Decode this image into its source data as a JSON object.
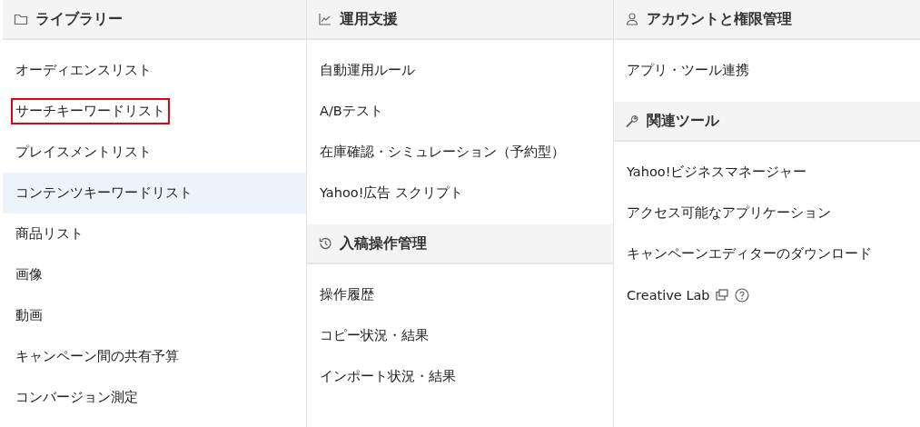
{
  "columns": [
    {
      "sections": [
        {
          "title": "ライブラリー",
          "kind": "folder",
          "items": [
            {
              "label": "オーディエンスリスト",
              "kind": "link",
              "highlighted": false,
              "marked": false
            },
            {
              "label": "サーチキーワードリスト",
              "kind": "link",
              "highlighted": false,
              "marked": true
            },
            {
              "label": "プレイスメントリスト",
              "kind": "link",
              "highlighted": false,
              "marked": false
            },
            {
              "label": "コンテンツキーワードリスト",
              "kind": "link",
              "highlighted": true,
              "marked": false
            },
            {
              "label": "商品リスト",
              "kind": "link",
              "highlighted": false,
              "marked": false
            },
            {
              "label": "画像",
              "kind": "link",
              "highlighted": false,
              "marked": false
            },
            {
              "label": "動画",
              "kind": "link",
              "highlighted": false,
              "marked": false
            },
            {
              "label": "キャンペーン間の共有予算",
              "kind": "link",
              "highlighted": false,
              "marked": false
            },
            {
              "label": "コンバージョン測定",
              "kind": "link",
              "highlighted": false,
              "marked": false
            }
          ]
        }
      ]
    },
    {
      "sections": [
        {
          "title": "運用支援",
          "kind": "chart",
          "items": [
            {
              "label": "自動運用ルール",
              "kind": "link",
              "highlighted": false,
              "marked": false
            },
            {
              "label": "A/Bテスト",
              "kind": "link",
              "highlighted": false,
              "marked": false
            },
            {
              "label": "在庫確認・シミュレーション（予約型）",
              "kind": "link",
              "highlighted": false,
              "marked": false
            },
            {
              "label": "Yahoo!広告 スクリプト",
              "kind": "link",
              "highlighted": false,
              "marked": false
            }
          ]
        },
        {
          "title": "入稿操作管理",
          "kind": "history",
          "items": [
            {
              "label": "操作履歴",
              "kind": "link",
              "highlighted": false,
              "marked": false
            },
            {
              "label": "コピー状況・結果",
              "kind": "link",
              "highlighted": false,
              "marked": false
            },
            {
              "label": "インポート状況・結果",
              "kind": "link",
              "highlighted": false,
              "marked": false
            }
          ]
        }
      ]
    },
    {
      "sections": [
        {
          "title": "アカウントと権限管理",
          "kind": "user",
          "items": [
            {
              "label": "アプリ・ツール連携",
              "kind": "link",
              "highlighted": false,
              "marked": false
            }
          ]
        },
        {
          "title": "関連ツール",
          "kind": "wrench",
          "items": [
            {
              "label": "Yahoo!ビジネスマネージャー",
              "kind": "link",
              "highlighted": false,
              "marked": false
            },
            {
              "label": "アクセス可能なアプリケーション",
              "kind": "link",
              "highlighted": false,
              "marked": false
            },
            {
              "label": "キャンペーンエディターのダウンロード",
              "kind": "link",
              "highlighted": false,
              "marked": false
            },
            {
              "label": "Creative Lab",
              "kind": "external-link",
              "highlighted": false,
              "marked": false
            }
          ]
        }
      ]
    }
  ]
}
